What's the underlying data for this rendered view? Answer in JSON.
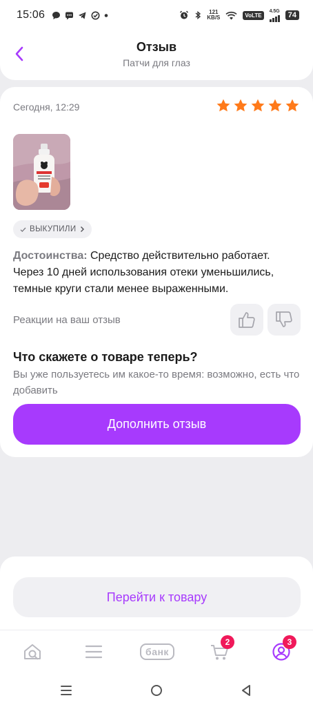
{
  "status_bar": {
    "time": "15:06",
    "network_speed_value": "121",
    "network_speed_unit": "KB/S",
    "volte": "VoLTE",
    "network_type": "4.5G",
    "battery": "74"
  },
  "header": {
    "title": "Отзыв",
    "subtitle": "Патчи для глаз"
  },
  "review": {
    "date": "Сегодня, 12:29",
    "rating": 5,
    "star_color": "#ff7a1a",
    "bought_badge": "ВЫКУПИЛИ",
    "advantages_label": "Достоинства:",
    "advantages_text": " Средство действительно работает. Через 10 дней использования отеки уменьшились, темные круги стали менее выраженными.",
    "reactions_label": "Реакции на ваш отзыв"
  },
  "prompt": {
    "title": "Что скажете о товаре теперь?",
    "text": "Вы уже пользуетесь им какое-то время: возможно, есть что добавить",
    "button_label": "Дополнить отзыв"
  },
  "bottom": {
    "goto_product_label": "Перейти к товару"
  },
  "bottom_nav": {
    "bank_label": "банк",
    "cart_badge": "2",
    "profile_badge": "3"
  },
  "colors": {
    "accent": "#a73afd",
    "badge": "#f0195a"
  }
}
